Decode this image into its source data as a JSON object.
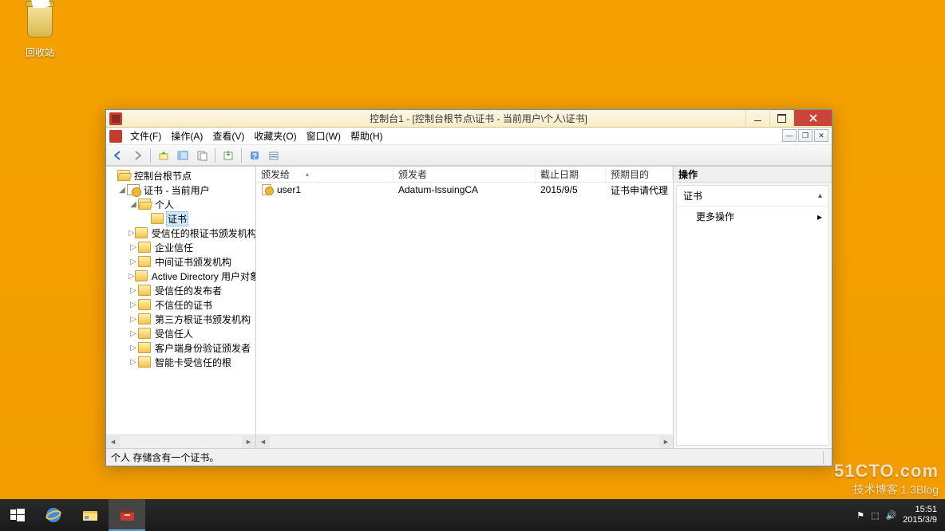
{
  "desktop": {
    "recycle_bin": "回收站"
  },
  "window": {
    "title": "控制台1 - [控制台根节点\\证书 - 当前用户\\个人\\证书]",
    "menus": {
      "file": "文件(F)",
      "action": "操作(A)",
      "view": "查看(V)",
      "favorites": "收藏夹(O)",
      "window": "窗口(W)",
      "help": "帮助(H)"
    },
    "status": "个人 存储含有一个证书。"
  },
  "tree": {
    "root": "控制台根节点",
    "cert_user": "证书 - 当前用户",
    "personal": "个人",
    "certificates": "证书",
    "items": [
      "受信任的根证书颁发机构",
      "企业信任",
      "中间证书颁发机构",
      "Active Directory 用户对象",
      "受信任的发布者",
      "不信任的证书",
      "第三方根证书颁发机构",
      "受信任人",
      "客户端身份验证颁发者",
      "智能卡受信任的根"
    ]
  },
  "list": {
    "headers": {
      "issued_to": "颁发给",
      "issued_by": "颁发者",
      "expiry": "截止日期",
      "purpose": "预期目的"
    },
    "rows": [
      {
        "issued_to": "user1",
        "issued_by": "Adatum-IssuingCA",
        "expiry": "2015/9/5",
        "purpose": "证书申请代理"
      }
    ]
  },
  "actions": {
    "pane_title": "操作",
    "group": "证书",
    "more": "更多操作"
  },
  "taskbar": {
    "time": "15:51",
    "date": "2015/3/9"
  },
  "watermark": {
    "site": "51CTO.com",
    "sub": "技术博客  1.3Blog"
  }
}
